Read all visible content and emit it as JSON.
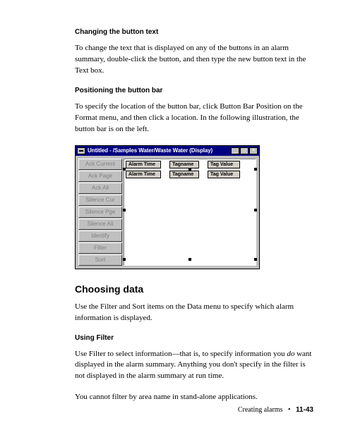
{
  "sec1": {
    "heading": "Changing the button text",
    "para": "To change the text that is displayed on any of the buttons in an alarm summary, double-click the button, and then type the new button text in the Text box."
  },
  "sec2": {
    "heading": "Positioning the button bar",
    "para": "To specify the location of the button bar, click Button Bar Position on the Format menu, and then click a location. In the following illustration, the button bar is on the left."
  },
  "window": {
    "title": "Untitled - /Samples Water/Waste Water (Display)",
    "minimize": "_",
    "maximize": "□",
    "close": "×",
    "buttons": [
      "Ack Current",
      "Ack Page",
      "Ack All",
      "Silence Cur",
      "Silence Pge",
      "Silence All",
      "Identify",
      "Filter",
      "Sort"
    ],
    "cols": {
      "c1": "Alarm Time",
      "c2": "Tagname",
      "c3": "Tag Value"
    }
  },
  "sec3": {
    "heading": "Choosing data",
    "para": "Use the Filter and Sort items on the Data menu to specify which alarm information is displayed."
  },
  "sec4": {
    "heading": "Using Filter",
    "para1a": "Use Filter to select information—that is, to specify information you ",
    "para1_do": "do",
    "para1b": " want displayed in the alarm summary. Anything you don't specify in the filter is not displayed in the alarm summary at run time.",
    "para2": "You cannot filter by area name in stand-alone applications."
  },
  "footer": {
    "text": "Creating alarms",
    "bullet": "•",
    "page": "11-43"
  }
}
